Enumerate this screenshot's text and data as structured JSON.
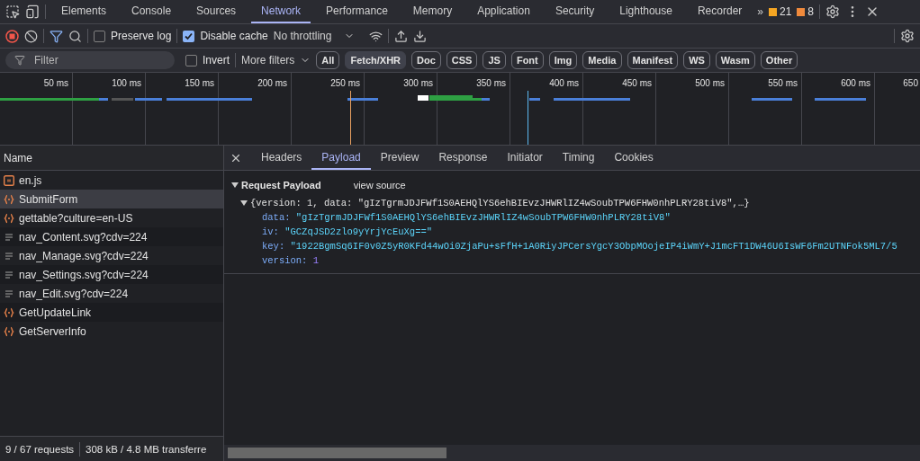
{
  "panel_tabs": [
    {
      "label": "Elements",
      "selected": false
    },
    {
      "label": "Console",
      "selected": false
    },
    {
      "label": "Sources",
      "selected": false
    },
    {
      "label": "Network",
      "selected": true
    },
    {
      "label": "Performance",
      "selected": false
    },
    {
      "label": "Memory",
      "selected": false
    },
    {
      "label": "Application",
      "selected": false
    },
    {
      "label": "Security",
      "selected": false
    },
    {
      "label": "Lighthouse",
      "selected": false
    },
    {
      "label": "Recorder",
      "selected": false
    }
  ],
  "more_tabs": "»",
  "badges": [
    {
      "kind": "warning",
      "count": "21"
    },
    {
      "kind": "issue",
      "count": "8"
    }
  ],
  "toolbar": {
    "recording": true,
    "preserve_log": {
      "label": "Preserve log",
      "checked": false
    },
    "disable_cache": {
      "label": "Disable cache",
      "checked": true
    },
    "throttling": "No throttling"
  },
  "filter_bar": {
    "placeholder": "Filter",
    "invert": {
      "label": "Invert",
      "checked": false
    },
    "more_filters": "More filters",
    "types": [
      {
        "label": "All",
        "selected": false
      },
      {
        "label": "Fetch/XHR",
        "selected": true
      },
      {
        "label": "Doc",
        "selected": false
      },
      {
        "label": "CSS",
        "selected": false
      },
      {
        "label": "JS",
        "selected": false
      },
      {
        "label": "Font",
        "selected": false
      },
      {
        "label": "Img",
        "selected": false
      },
      {
        "label": "Media",
        "selected": false
      },
      {
        "label": "Manifest",
        "selected": false
      },
      {
        "label": "WS",
        "selected": false
      },
      {
        "label": "Wasm",
        "selected": false
      },
      {
        "label": "Other",
        "selected": false
      }
    ]
  },
  "timeline": {
    "ticks": [
      "50 ms",
      "100 ms",
      "150 ms",
      "200 ms",
      "250 ms",
      "300 ms",
      "350 ms",
      "400 ms",
      "450 ms",
      "500 ms",
      "550 ms",
      "600 ms",
      "650"
    ]
  },
  "requests": {
    "column": "Name",
    "rows": [
      {
        "name": "en.js",
        "kind": "script",
        "selected": false
      },
      {
        "name": "SubmitForm",
        "kind": "fetch",
        "selected": true
      },
      {
        "name": "gettable?culture=en-US",
        "kind": "fetch",
        "selected": false
      },
      {
        "name": "nav_Content.svg?cdv=224",
        "kind": "image",
        "selected": false
      },
      {
        "name": "nav_Manage.svg?cdv=224",
        "kind": "image",
        "selected": false
      },
      {
        "name": "nav_Settings.svg?cdv=224",
        "kind": "image",
        "selected": false
      },
      {
        "name": "nav_Edit.svg?cdv=224",
        "kind": "image",
        "selected": false
      },
      {
        "name": "GetUpdateLink",
        "kind": "fetch",
        "selected": false
      },
      {
        "name": "GetServerInfo",
        "kind": "fetch",
        "selected": false
      }
    ]
  },
  "status_bar": {
    "requests": "9 / 67 requests",
    "transferred": "308 kB / 4.8 MB transferre"
  },
  "detail_tabs": [
    {
      "label": "Headers",
      "selected": false
    },
    {
      "label": "Payload",
      "selected": true
    },
    {
      "label": "Preview",
      "selected": false
    },
    {
      "label": "Response",
      "selected": false
    },
    {
      "label": "Initiator",
      "selected": false
    },
    {
      "label": "Timing",
      "selected": false
    },
    {
      "label": "Cookies",
      "selected": false
    }
  ],
  "payload": {
    "title": "Request Payload",
    "expanded": true,
    "view_source": "view source",
    "summary": "{version: 1, data: \"gIzTgrmJDJFWf1S0AEHQlYS6ehBIEvzJHWRlIZ4wSoubTPW6FHW0nhPLRY28tiV8\",…}",
    "properties": [
      {
        "key": "data:",
        "value": "\"gIzTgrmJDJFWf1S0AEHQlYS6ehBIEvzJHWRlIZ4wSoubTPW6FHW0nhPLRY28tiV8\"",
        "kind": "string"
      },
      {
        "key": "iv:",
        "value": "\"GCZqJSD2zlo9yYrjYcEuXg==\"",
        "kind": "string"
      },
      {
        "key": "key:",
        "value": "\"1922BgmSq6IF0v0Z5yR0KFd44wOi0ZjaPu+sFfH+1A0RiyJPCersYgcY3ObpMOojeIP4iWmY+J1mcFT1DW46U6IsWF6Fm2UTNFok5ML7/5",
        "kind": "string"
      },
      {
        "key": "version:",
        "value": "1",
        "kind": "number"
      }
    ]
  }
}
